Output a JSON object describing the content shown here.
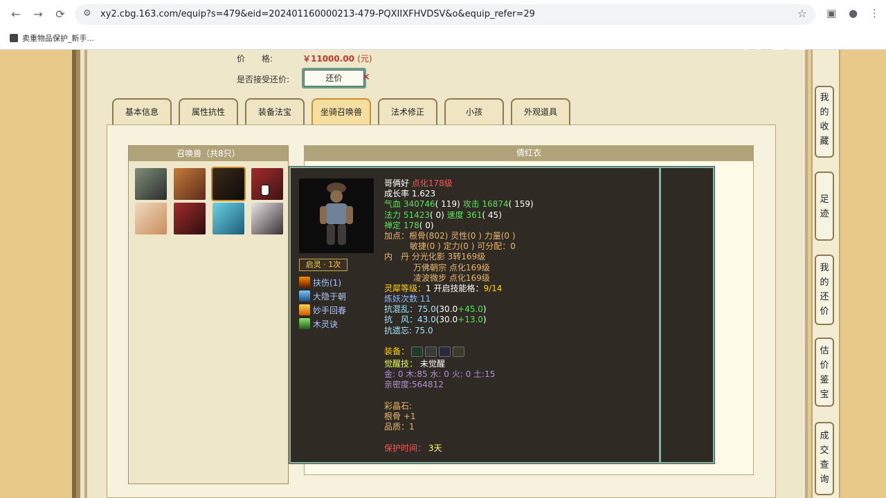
{
  "browser": {
    "url": "xy2.cbg.163.com/equip?s=479&eid=202401160000213-479-PQXIIXFHVDSV&o&equip_refer=29",
    "bookmark": "卖重物品保护_新手..."
  },
  "watermark": "CC直播",
  "price": {
    "label": "价　　格:",
    "value": "￥11000.00",
    "unit": "(元)"
  },
  "counter": {
    "label": "是否接受还价:",
    "button": "还价"
  },
  "tabs": [
    "基本信息",
    "属性抗性",
    "装备法宝",
    "坐骑召唤兽",
    "法术修正",
    "小孩",
    "外观道具"
  ],
  "active_tab": 3,
  "summon_header": "召唤兽（共8只）",
  "detail_header": "倩红衣",
  "tooltip": {
    "qiling": "启灵 · 1次",
    "skills": [
      "扶伤(1)",
      "大隐于朝",
      "妙手回春",
      "木灵诀"
    ],
    "name": "哥俩好",
    "level": "点化178级",
    "growth": "成长率 1.623",
    "hp_label": "气血",
    "hp": "340746",
    "hp_extra": "( 119)",
    "atk_label": "攻击",
    "atk": "16874",
    "atk_extra": "( 159)",
    "mp_label": "法力",
    "mp": "51423",
    "mp_extra": "( 0)",
    "spd_label": "速度",
    "spd": "361",
    "spd_extra": "( 45)",
    "ding_label": "禅定",
    "ding": "178",
    "ding_extra": "( 0)",
    "points1": "加点：根骨(802) 灵性(0 ) 力量(0 )",
    "points2": "敏捷(0 ) 定力(0 ) 可分配：0",
    "neidan_label": "内　丹",
    "neidan1": "分光化影 3转169级",
    "neidan2": "万佛朝宗 点化169级",
    "neidan3": "凌波微步 点化169级",
    "lingxi_label": "灵犀等级：",
    "lingxi_value": "1 开启技能格：",
    "lingxi_slots": "9/14",
    "lianyao_label": "炼妖次数",
    "lianyao_value": "11",
    "resist1_label": "抗混乱：",
    "resist1_total": "75.0",
    "resist1_open": "(",
    "resist1_base": "30.0",
    "resist1_bonus": "+45.0",
    "resist1_close": ")",
    "resist2_label": "抗　风：",
    "resist2_total": "43.0",
    "resist2_open": "(",
    "resist2_base": "30.0",
    "resist2_bonus": "+13.0",
    "resist2_close": ")",
    "resist3": "抗遗忘: 75.0",
    "equip_label": "装备：",
    "awaken_label": "觉醒技：",
    "awaken_value": "未觉醒",
    "elements": "金: 0 木:85 水: 0 火: 0 土:15",
    "intimacy": "亲密度:564812",
    "colorstone_label": "彩晶石:",
    "colorstone_attr": "根骨 +1",
    "quality": "品质：1",
    "protect_label": "保护时间：",
    "protect_value": "3天"
  },
  "side_nav": [
    "我的收藏",
    "足迹",
    "我的还价",
    "估价鉴宝",
    "成交查询"
  ]
}
